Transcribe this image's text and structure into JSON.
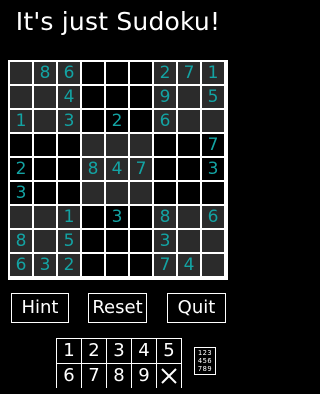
{
  "title": "It's just Sudoku!",
  "colors": {
    "given_digit": "#13a3a3",
    "grid_line": "#ffffff",
    "background": "#000000",
    "shaded_box": "#2b2b2b"
  },
  "board": [
    [
      "",
      "8",
      "6",
      "",
      "",
      "",
      "2",
      "7",
      "1"
    ],
    [
      "",
      "",
      "4",
      "",
      "",
      "",
      "9",
      "",
      "5"
    ],
    [
      "1",
      "",
      "3",
      "",
      "2",
      "",
      "6",
      "",
      ""
    ],
    [
      "",
      "",
      "",
      "",
      "",
      "",
      "",
      "",
      "7"
    ],
    [
      "2",
      "",
      "",
      "8",
      "4",
      "7",
      "",
      "",
      "3"
    ],
    [
      "3",
      "",
      "",
      "",
      "",
      "",
      "",
      "",
      ""
    ],
    [
      "",
      "",
      "1",
      "",
      "3",
      "",
      "8",
      "",
      "6"
    ],
    [
      "8",
      "",
      "5",
      "",
      "",
      "",
      "3",
      "",
      ""
    ],
    [
      "6",
      "3",
      "2",
      "",
      "",
      "",
      "7",
      "4",
      ""
    ]
  ],
  "buttons": {
    "hint": "Hint",
    "reset": "Reset",
    "quit": "Quit"
  },
  "keypad": [
    [
      "1",
      "2",
      "3",
      "4",
      "5"
    ],
    [
      "6",
      "7",
      "8",
      "9",
      "clear-x-icon"
    ]
  ],
  "notes_toggle": {
    "icon": "pencil-marks-grid-icon",
    "digits": [
      "123",
      "456",
      "789"
    ]
  }
}
